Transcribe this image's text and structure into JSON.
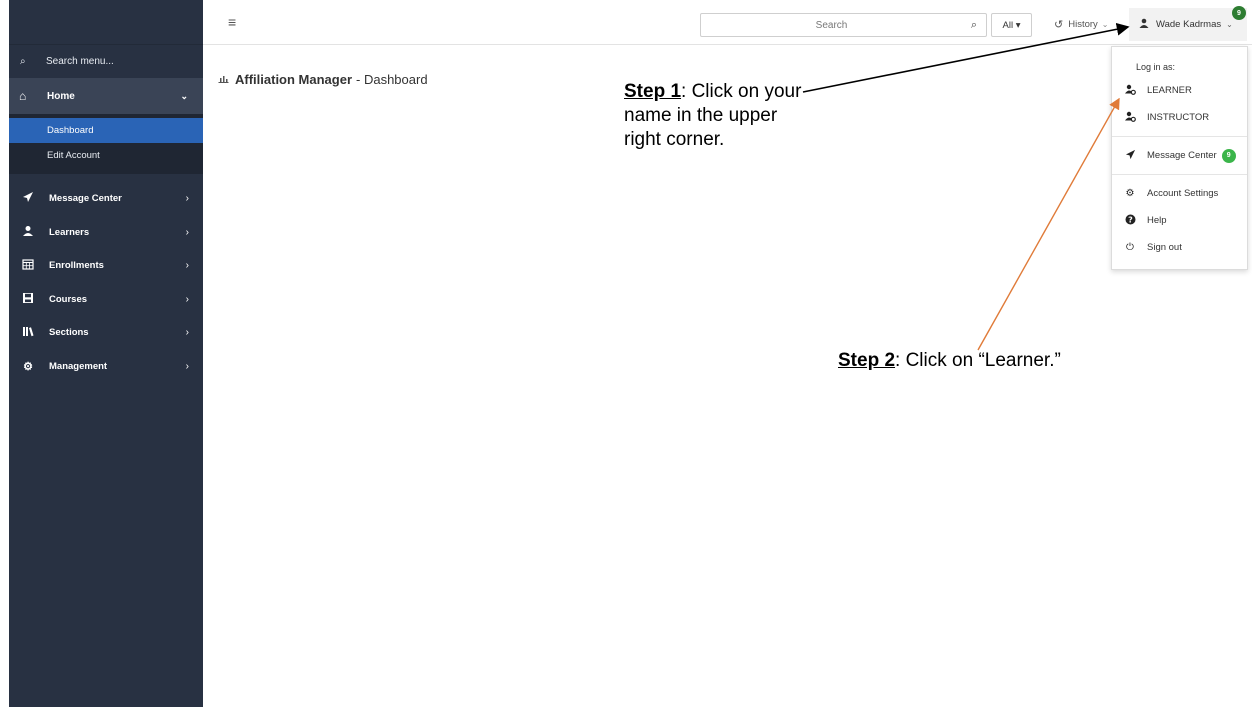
{
  "sidebar": {
    "search_label": "Search menu...",
    "home": {
      "label": "Home"
    },
    "subitems": [
      {
        "label": "Dashboard",
        "active": true
      },
      {
        "label": "Edit Account",
        "active": false
      }
    ],
    "items": [
      {
        "label": "Message Center",
        "icon": "paper-plane-icon"
      },
      {
        "label": "Learners",
        "icon": "learner-icon"
      },
      {
        "label": "Enrollments",
        "icon": "calendar-icon"
      },
      {
        "label": "Courses",
        "icon": "floppy-icon"
      },
      {
        "label": "Sections",
        "icon": "library-icon"
      },
      {
        "label": "Management",
        "icon": "gear-icon"
      }
    ],
    "colors": {
      "background": "#283142",
      "active": "#2a64b6"
    }
  },
  "topbar": {
    "search_placeholder": "Search",
    "all_label": "All ▾",
    "history_label": "History",
    "user_name": "Wade Kadrmas",
    "badge_count": "9"
  },
  "page": {
    "title_bold": "Affiliation Manager",
    "title_rest": "- Dashboard"
  },
  "dropdown": {
    "header": "Log in as:",
    "roles": [
      {
        "label": "LEARNER"
      },
      {
        "label": "INSTRUCTOR"
      }
    ],
    "message_center": {
      "label": "Message Center",
      "badge": "9"
    },
    "links": [
      {
        "label": "Account Settings",
        "icon": "gear-icon"
      },
      {
        "label": "Help",
        "icon": "question-circle-icon"
      },
      {
        "label": "Sign out",
        "icon": "power-icon"
      }
    ]
  },
  "annotations": {
    "step1_label": "Step 1",
    "step1_text": ": Click on your name in the upper right corner.",
    "step2_label": "Step 2",
    "step2_text": ": Click on “Learner.”",
    "arrow_colors": {
      "step1": "#000000",
      "step2": "#e07b39"
    }
  }
}
